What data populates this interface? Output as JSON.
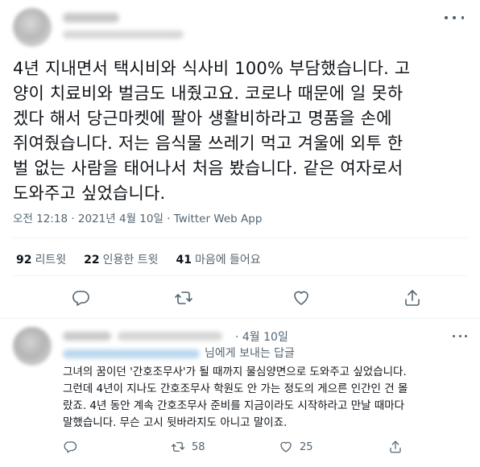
{
  "tweet": {
    "text": "4년 지내면서 택시비와 식사비 100% 부담했습니다. 고\n양이 치료비와 벌금도 내줬고요. 코로나 때문에 일 못하\n겠다 해서 당근마켓에 팔아 생활비하라고 명품을 손에\n쥐여줬습니다. 저는 음식물 쓰레기 먹고 겨울에 외투 한\n벌 없는 사람을 태어나서 처음 봤습니다. 같은 여자로서\n도와주고 싶었습니다.",
    "timestamp": "오전 12:18 · 2021년 4월 10일 · Twitter Web App",
    "stats": {
      "retweets_count": "92",
      "retweets_label": "리트윗",
      "quotes_count": "22",
      "quotes_label": "인용한 트윗",
      "likes_count": "41",
      "likes_label": "마음에 들어요"
    },
    "actions": [
      "reply-icon",
      "retweet-icon",
      "like-icon",
      "share-icon"
    ]
  },
  "reply": {
    "date": "· 4월 10일",
    "replying_to_suffix": "님에게 보내는 답글",
    "text": "그녀의 꿈이던 '간호조무사'가 될 때까지 물심양면으로 도와주고 싶었습니다.\n그런데 4년이 지나도 간호조무사 학원도 안 가는 정도의 게으른 인간인 건 몰\n랐죠. 4년 동안 계속 간호조무사 준비를 지금이라도 시작하라고 만날 때마다\n말했습니다. 무슨 고시 뒷바라지도 아니고 말이죠.",
    "replies": "",
    "retweets": "58",
    "likes": "25"
  },
  "colors": {
    "text": "#0f1419",
    "secondary": "#536471",
    "divider": "#eff3f4"
  }
}
